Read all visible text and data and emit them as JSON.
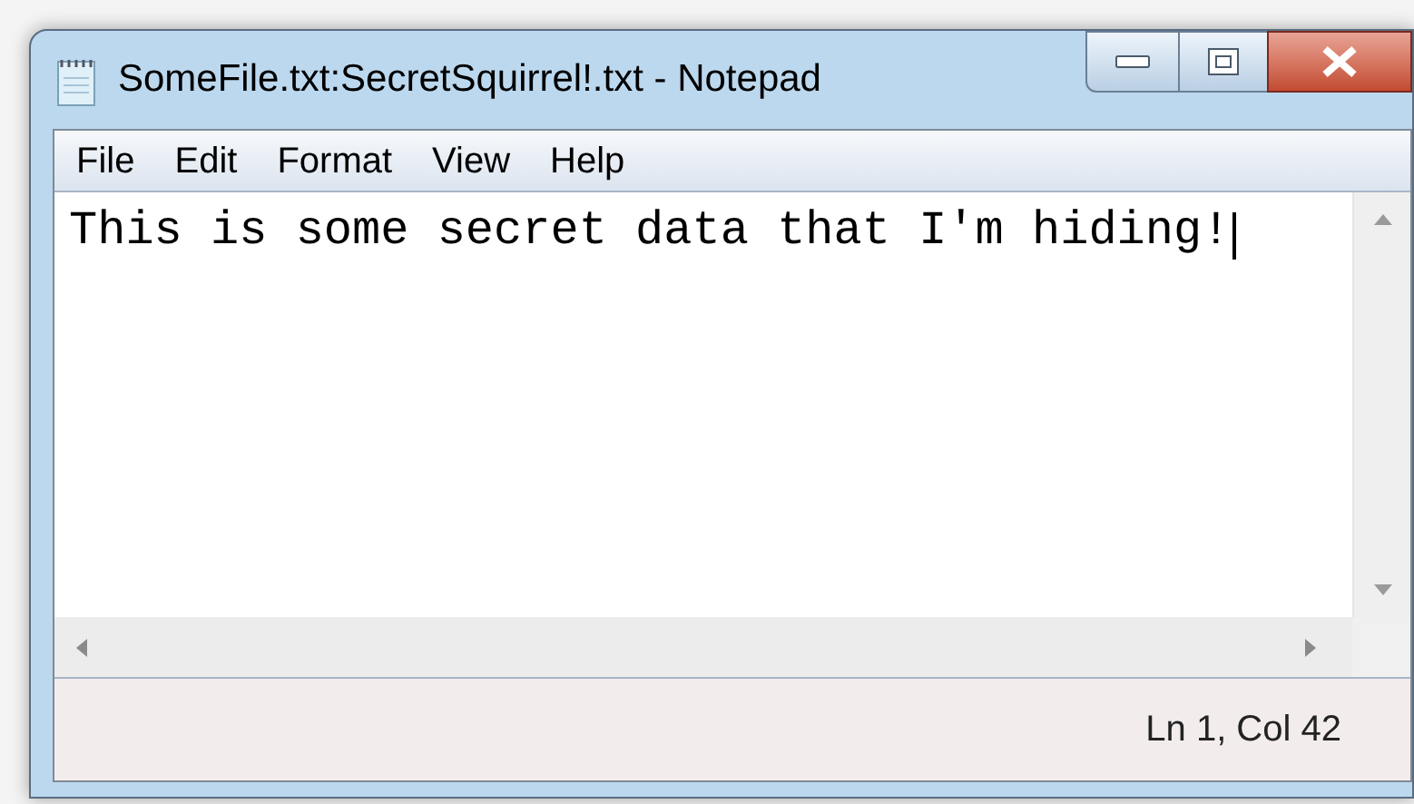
{
  "window": {
    "title": "SomeFile.txt:SecretSquirrel!.txt - Notepad"
  },
  "menu": [
    "File",
    "Edit",
    "Format",
    "View",
    "Help"
  ],
  "editor": {
    "text": "This is some secret data that I'm hiding!"
  },
  "status_bar": {
    "position": "Ln 1, Col 42"
  }
}
